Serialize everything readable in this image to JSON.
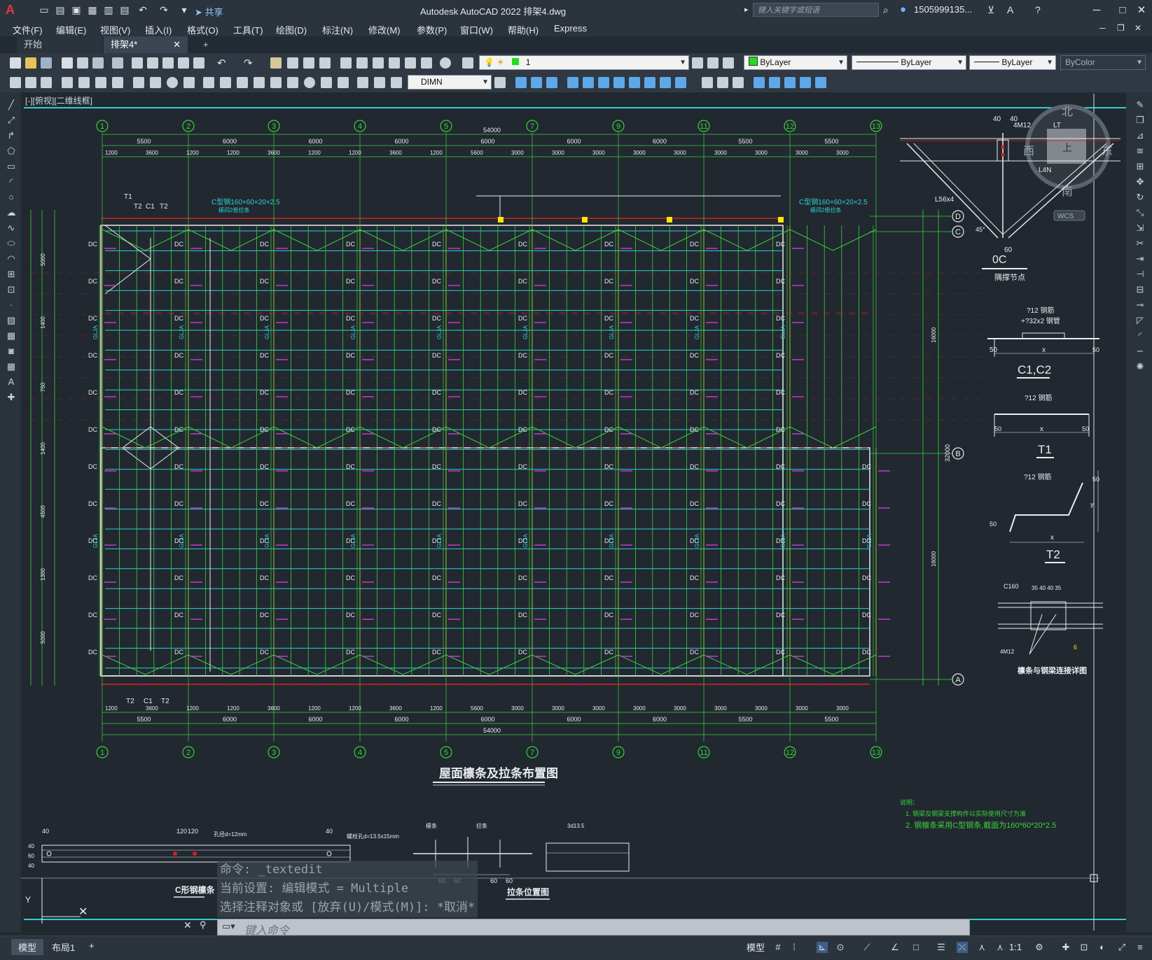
{
  "app": {
    "title": "Autodesk AutoCAD 2022    排架4.dwg",
    "search_placeholder": "键入关键字或短语",
    "user": "1505999135...",
    "share_label": "共享"
  },
  "menu": [
    "文件(F)",
    "编辑(E)",
    "视图(V)",
    "插入(I)",
    "格式(O)",
    "工具(T)",
    "绘图(D)",
    "标注(N)",
    "修改(M)",
    "参数(P)",
    "窗口(W)",
    "帮助(H)",
    "Express"
  ],
  "tabs": [
    {
      "label": "开始"
    },
    {
      "label": "排架4*"
    }
  ],
  "toolbar": {
    "layer_value": "1",
    "color_value": "ByLayer",
    "linetype_value": "ByLayer",
    "lineweight_value": "ByLayer",
    "plotstyle_value": "ByColor",
    "dimstyle_value": "DIMN"
  },
  "view_label": "[-][俯视][二维线框]",
  "drawing": {
    "main_title": "屋面檩条及拉条布置图",
    "grid_cols": [
      "1",
      "2",
      "3",
      "4",
      "5",
      "7",
      "9",
      "11",
      "12",
      "13"
    ],
    "grid_rows": [
      "D",
      "C",
      "B",
      "A"
    ],
    "total_dim": "54000",
    "top_dims": [
      "5500",
      "6000",
      "6000",
      "6000",
      "6000",
      "6000",
      "6000",
      "5500",
      "5500"
    ],
    "bottom_dims": [
      "5500",
      "6000",
      "6000",
      "6000",
      "6000",
      "6000",
      "6000",
      "5500",
      "5500"
    ],
    "sub_dims": [
      "1200",
      "3600",
      "1200",
      "1200",
      "3600",
      "1200",
      "1200",
      "3600",
      "1200",
      "5600",
      "3000",
      "3000",
      "3000",
      "3000",
      "3000",
      "3000",
      "3000",
      "3000",
      "3000"
    ],
    "left_dims": [
      "5000",
      "1400",
      "750",
      "1400",
      "4500",
      "1300",
      "5000"
    ],
    "right_total": "32000",
    "right_half": "16000",
    "purlin_label_left": "C型钢160×60×20×2.5",
    "purlin_label_left_sub": "檩间2根拉条",
    "purlin_label_right": "C型钢160×60×20×2.5",
    "purlin_label_right_sub": "檩间2根拉条",
    "member_labels": [
      "T1",
      "T2",
      "C1",
      "C2",
      "DC",
      "GLJA"
    ],
    "details": [
      {
        "title": "0C",
        "subtitle": "隅撑节点",
        "labels": [
          "40",
          "40",
          "4M12",
          "LT",
          "L56x4",
          "L4N",
          "45°",
          "60"
        ]
      },
      {
        "title": "C1,C2",
        "labels": [
          "?12 钢筋",
          "+?32x2 钢管",
          "50",
          "x",
          "50"
        ]
      },
      {
        "title": "T1",
        "labels": [
          "?12 钢筋",
          "50",
          "x",
          "50"
        ]
      },
      {
        "title": "T2",
        "labels": [
          "?12 钢筋",
          "50",
          "x",
          "50",
          "y"
        ]
      },
      {
        "title": "檩条与钢梁连接详图",
        "labels": [
          "C160",
          "35 40 40 35",
          "4M12",
          "6"
        ]
      }
    ],
    "notes_title": "说明：",
    "notes": [
      "1. 钢梁及钢梁支撑构件以实际使用尺寸为准",
      "2. 钢檩条采用C型钢条,截面为160*60*20*2.5"
    ],
    "bottom_details": [
      {
        "title": "C形钢檩条",
        "labels": [
          "40",
          "120",
          "120",
          "孔径d=12mm",
          "40",
          "螺栓孔d=13.5x15mm",
          "40",
          "60",
          "40"
        ]
      },
      {
        "title": "拉条位置图",
        "labels": [
          "檩条",
          "拉条",
          "60",
          "60",
          "60",
          "60",
          "3d13.5"
        ]
      }
    ],
    "compass": {
      "north": "北",
      "south": "南",
      "east": "东",
      "west": "西",
      "top": "上",
      "wcs": "WCS"
    }
  },
  "command": {
    "history": [
      "命令: _textedit",
      "当前设置: 编辑模式 = Multiple",
      "选择注释对象或 [放弃(U)/模式(M)]: *取消*"
    ],
    "placeholder": "键入命令"
  },
  "status": {
    "tabs": [
      "模型",
      "布局1"
    ],
    "mode": "模型",
    "scale": "1:1"
  },
  "colors": {
    "background": "#212830",
    "grid_green": "#3bd13b",
    "purlin_cyan": "#2fd0d0",
    "axis_red": "#d42020",
    "white": "#e9ecef",
    "marker_yellow": "#ffe600"
  }
}
